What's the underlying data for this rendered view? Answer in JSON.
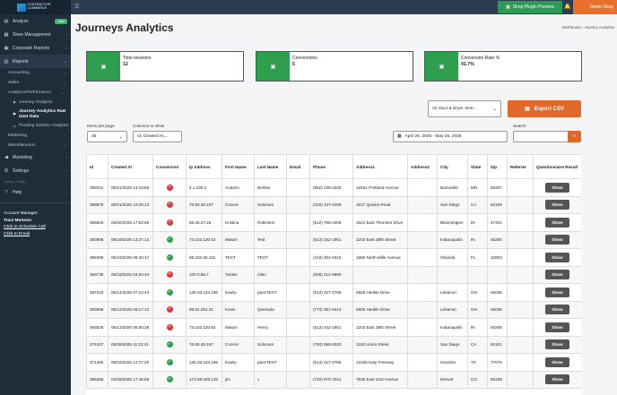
{
  "sidebar": {
    "logo_text": "CONTRACTOR COMMERCE",
    "items": [
      {
        "label": "Analyze",
        "badge": "New",
        "icon": "chart-icon"
      },
      {
        "label": "Store Management",
        "icon": "store-icon"
      },
      {
        "label": "Corporate Reports",
        "icon": "file-icon"
      },
      {
        "label": "Reports",
        "icon": "report-icon"
      }
    ],
    "reports_sub": [
      "Accounting",
      "Sales",
      "Analytics/Performance"
    ],
    "analytics_sub": [
      "Journey Analytics",
      "Journey Analytics Raw User Data",
      "Floating Sidebar Analytics"
    ],
    "reports_sub2": [
      "Marketing",
      "Miscellaneous"
    ],
    "items2": [
      {
        "label": "Marketing",
        "icon": "megaphone-icon"
      },
      {
        "label": "Settings",
        "icon": "gear-icon"
      }
    ],
    "collapse_text": "Setup & Help",
    "help_label": "Help",
    "account": {
      "title": "Account Manager:",
      "name": "Traci Monson",
      "link1": "Click to Schedule Call",
      "link2": "Click to Email"
    }
  },
  "topbar": {
    "plugin_preview": "Shop Plugin Preview",
    "shop_name": "Demo Shop"
  },
  "header": {
    "title": "Journeys Analytics",
    "breadcrumb": "Dashboard  ›  Journey Analytics"
  },
  "stats": [
    {
      "label": "Total sessions",
      "value": "12"
    },
    {
      "label": "Conversions",
      "value": "5"
    },
    {
      "label": "Conversion Rate %",
      "value": "41.7%"
    }
  ],
  "controls": {
    "product_select": "Air Duct & Dryer Vent...",
    "export_label": "Export CSV",
    "items_per_page_label": "Items per page",
    "items_per_page_value": "25",
    "columns_label": "Columns to show",
    "columns_value": "Id, Created At,...",
    "date_range": "April 26, 2025 - May 26, 2025",
    "search_label": "Search"
  },
  "table": {
    "headers": [
      "Id",
      "Created At",
      "Conversion",
      "Ip Address",
      "First Name",
      "Last Name",
      "Email",
      "Phone",
      "Address1",
      "Address2",
      "City",
      "State",
      "Zip",
      "Referrer",
      "Questionnaire Result"
    ],
    "show_label": "Show",
    "rows": [
      [
        "399241",
        "05/21/2025 13:18:56",
        "no",
        "4.1.190.2",
        "Autumn",
        "Brekke",
        "",
        "(952) 239-2225",
        "12501 Portland Avenue",
        "",
        "Burnsville",
        "MN",
        "55337",
        ""
      ],
      [
        "398875",
        "05/21/2025 10:26:12",
        "no",
        "76.93.48.157",
        "Connor",
        "Solomon",
        "",
        "(318) 347-4199",
        "1617 Quivira Road",
        "",
        "San Diego",
        "CA",
        "92109",
        ""
      ],
      [
        "396826",
        "05/20/2025 17:52:55",
        "no",
        "68.45.27.25",
        "Kristina",
        "Robinson",
        "",
        "(512) 788-4408",
        "1824 East Thornton Drive",
        "",
        "Bloomington",
        "IN",
        "47401",
        ""
      ],
      [
        "393895",
        "05/19/2025 13:37:13",
        "yes",
        "73.102.120.62",
        "Mason",
        "Test",
        "",
        "(513) 342-1951",
        "1202 East 38th Street",
        "",
        "Indianapolis",
        "IN",
        "46205",
        ""
      ],
      [
        "395399",
        "05/19/2025 09:30:17",
        "yes",
        "68.202.58.115",
        "TEST",
        "TEST",
        "",
        "(419) 304-0215",
        "1650 North Mills Avenue",
        "",
        "Orlando",
        "FL",
        "32803",
        ""
      ],
      [
        "393735",
        "05/18/2025 04:54:34",
        "no",
        "100.0.65.7",
        "Tucker",
        "Olen",
        "",
        "(508) 212-6880",
        "",
        "",
        "",
        "",
        "",
        ""
      ],
      [
        "387242",
        "05/14/2025 07:24:43",
        "yes",
        "135.26.123.196",
        "braely",
        "paceTEST",
        "",
        "(513) 427-2758",
        "2825 Henkle Drive",
        "",
        "Lebanon",
        "OH",
        "45036",
        ""
      ],
      [
        "383586",
        "05/12/2025 09:17:12",
        "no",
        "99.61.251.31",
        "Kevin",
        "Quezada",
        "",
        "(773) 351-9414",
        "2825 Henkle Drive",
        "",
        "Lebanon",
        "OH",
        "45036",
        ""
      ],
      [
        "383530",
        "05/12/2025 08:50:28",
        "no",
        "73.102.120.62",
        "Mason",
        "Henry",
        "",
        "(513) 342-1951",
        "1202 East 38th Street",
        "",
        "Indianapolis",
        "IN",
        "46205",
        ""
      ],
      [
        "374107",
        "05/05/2025 11:23:41",
        "yes",
        "76.93.48.157",
        "Connor",
        "Solomon",
        "",
        "(760) 555-5333",
        "1100 Union Street",
        "",
        "San Diego",
        "CA",
        "92101",
        ""
      ],
      [
        "371482",
        "05/02/2025 12:27:20",
        "yes",
        "135.26.123.196",
        "braely",
        "paceTEST",
        "",
        "(513) 427-2758",
        "12345 Katy Freeway",
        "",
        "Houston",
        "TX",
        "77079",
        ""
      ],
      [
        "366285",
        "04/28/2025 17:46:55",
        "yes",
        "172.59.229.133",
        "jim",
        "c",
        "",
        "(720) 670-7241",
        "7845 East 21st Avenue",
        "",
        "Denver",
        "CO",
        "80238",
        ""
      ]
    ]
  }
}
